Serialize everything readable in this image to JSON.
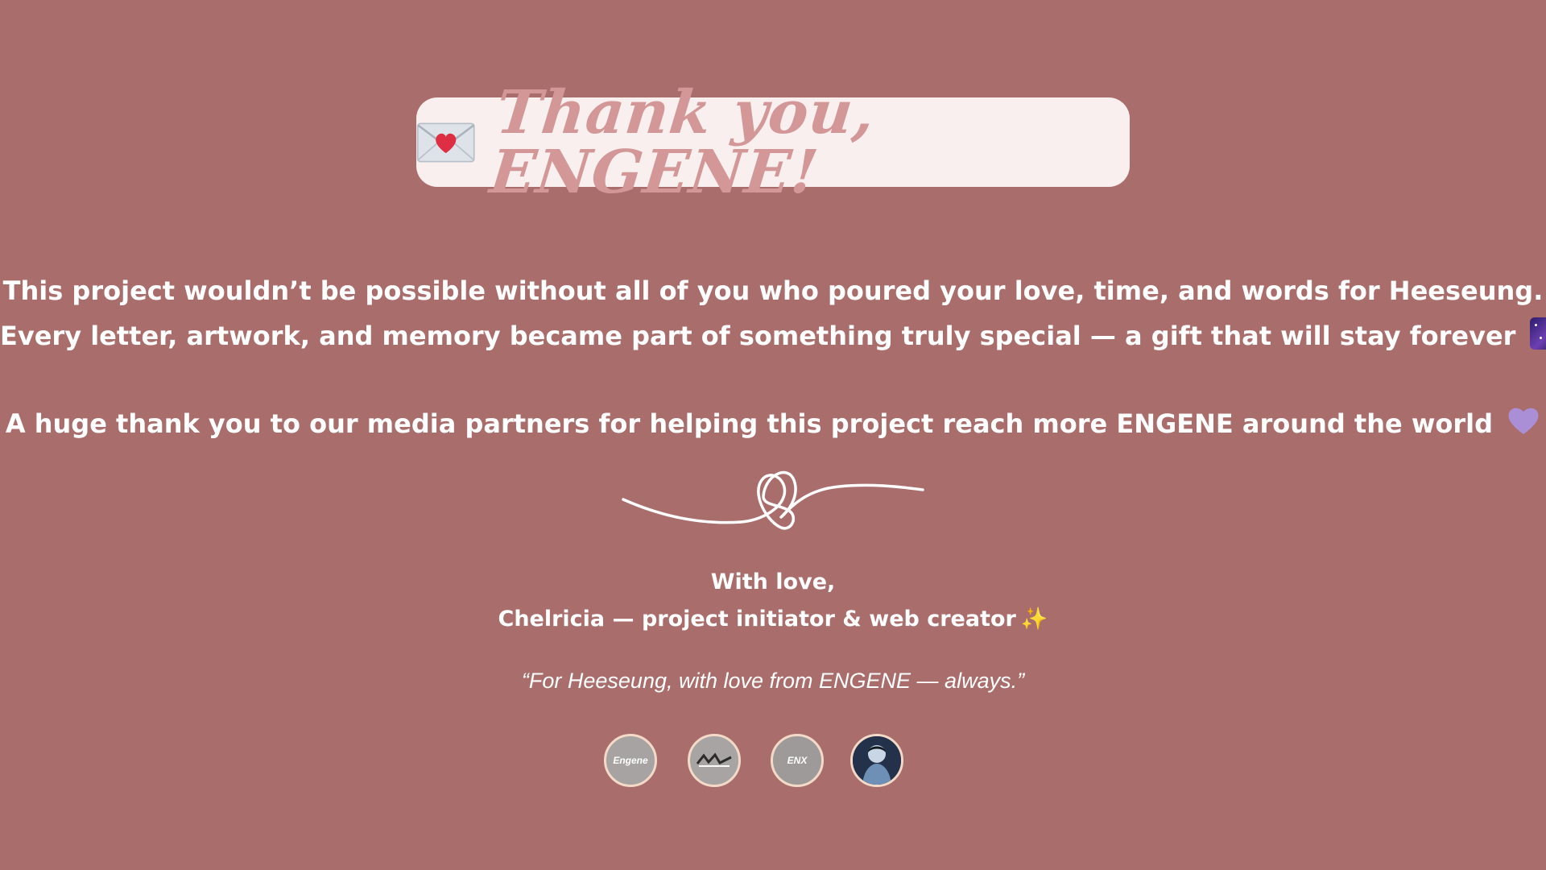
{
  "header": {
    "icon": "love-letter-icon",
    "title": "Thank you, ENGENE!"
  },
  "message": {
    "line1": "This project wouldn’t be possible without all of you who poured your love, time, and words for Heeseung.",
    "line2": "Every letter, artwork, and memory became part of something truly special — a gift that will stay forever",
    "line2_icon": "milky-way-icon",
    "line3": "A huge thank you to our media partners for helping this project reach more ENGENE around the world",
    "line3_icon": "purple-heart-icon"
  },
  "divider": {
    "icon": "heart-scribble-icon"
  },
  "signature": {
    "greeting": "With love,",
    "author": "Chelricia — project initiator & web creator",
    "author_icon": "sparkles-icon"
  },
  "quote": "“For Heeseung, with love from ENGENE — always.”",
  "partners": [
    {
      "icon": "engene-logo-icon",
      "label": "Engene"
    },
    {
      "icon": "partner-logo-icon"
    },
    {
      "icon": "enx-jakarta-logo-icon",
      "label": "ENX"
    },
    {
      "icon": "heeseung-photo-icon"
    }
  ],
  "colors": {
    "background": "#a96e6c",
    "card": "#f8efee",
    "title": "#d29796",
    "text": "#ffffff",
    "partner_border": "#f3d9c8"
  }
}
